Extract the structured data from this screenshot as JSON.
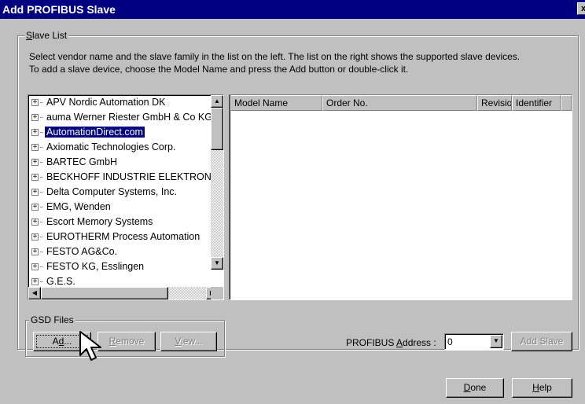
{
  "window": {
    "title": "Add PROFIBUS Slave",
    "close_symbol": "x"
  },
  "slave_list": {
    "group_title_mnemonic": "S",
    "group_title_rest": "lave List",
    "instructions_line1": "Select vendor name and the slave family in the list on the left. The list on the right shows the supported slave devices.",
    "instructions_line2": "To add a slave device, choose the Model Name and press the Add button or double-click it.",
    "vendors": [
      "APV Nordic Automation DK",
      "auma Werner Riester GmbH & Co KG",
      "AutomationDirect.com",
      "Axiomatic Technologies Corp.",
      "BARTEC GmbH",
      "BECKHOFF INDUSTRIE ELEKTRONIK",
      "Delta Computer Systems, Inc.",
      "EMG, Wenden",
      "Escort Memory Systems",
      "EUROTHERM Process Automation",
      "FESTO AG&Co.",
      "FESTO KG, Esslingen",
      "G.E.S."
    ],
    "selected_vendor": "AutomationDirect.com",
    "device_columns": [
      "Model Name",
      "Order No.",
      "Revision",
      "Identifier"
    ]
  },
  "gsd_files": {
    "group_title": "GSD Files",
    "add_mnemonic": "d",
    "add_pre": "A",
    "add_post": "...",
    "remove_mnemonic": "R",
    "remove_rest": "emove",
    "view_mnemonic": "V",
    "view_rest": "iew..."
  },
  "address": {
    "label_pre": "PROFIBUS ",
    "label_mnemonic": "A",
    "label_post": "ddress :",
    "value": "0"
  },
  "buttons": {
    "add_slave": "Add Slave",
    "done_mnemonic": "D",
    "done_rest": "one",
    "help_mnemonic": "H",
    "help_rest": "elp"
  },
  "icons": {
    "expander": "plus-box-icon",
    "cursor": "mouse-pointer-icon"
  }
}
